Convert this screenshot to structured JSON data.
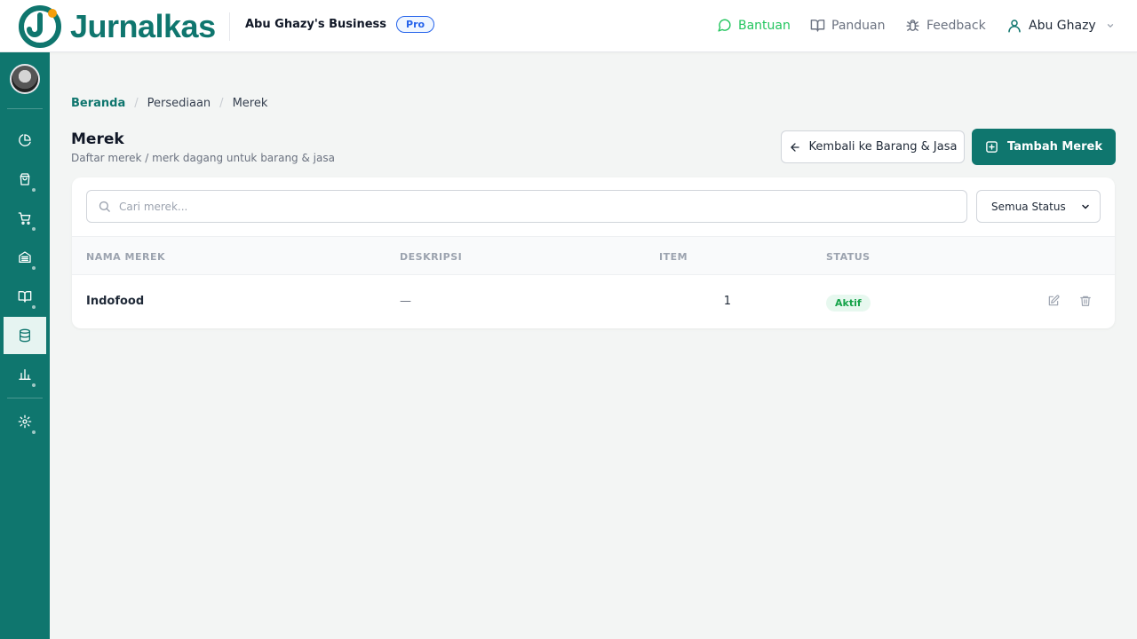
{
  "app": {
    "brand": "Jurnalkas",
    "business_name": "Abu Ghazy's Business",
    "plan_badge": "Pro",
    "accent": "#0f766e"
  },
  "header_nav": {
    "help": {
      "label": "Bantuan",
      "icon": "chat-bubble-icon"
    },
    "guide": {
      "label": "Panduan",
      "icon": "book-open-icon"
    },
    "feedback": {
      "label": "Feedback",
      "icon": "bug-icon"
    },
    "user": {
      "label": "Abu Ghazy",
      "icon": "user-icon"
    }
  },
  "sidebar": {
    "items": [
      {
        "name": "dashboard",
        "icon": "pie-chart-icon",
        "active": false
      },
      {
        "name": "sales",
        "icon": "shopping-bag-icon",
        "active": false
      },
      {
        "name": "purchases",
        "icon": "shopping-cart-icon",
        "active": false
      },
      {
        "name": "bank",
        "icon": "bank-icon",
        "active": false
      },
      {
        "name": "ledger",
        "icon": "book-icon",
        "active": false
      },
      {
        "name": "inventory",
        "icon": "database-icon",
        "active": true
      },
      {
        "name": "reports",
        "icon": "bar-chart-icon",
        "active": false
      },
      {
        "name": "settings",
        "icon": "gear-icon",
        "active": false
      }
    ]
  },
  "breadcrumb": {
    "home": "Beranda",
    "level1": "Persediaan",
    "current": "Merek",
    "separator": "/"
  },
  "page": {
    "title": "Merek",
    "subtitle": "Daftar merek / merk dagang untuk barang & jasa",
    "back_button": "Kembali ke Barang & Jasa",
    "add_button": "Tambah Merek"
  },
  "filters": {
    "search_placeholder": "Cari merek...",
    "search_value": "",
    "status_selected": "Semua Status"
  },
  "table": {
    "headers": {
      "name": "NAMA MEREK",
      "description": "DESKRIPSI",
      "items": "ITEM",
      "status": "STATUS"
    },
    "rows": [
      {
        "name": "Indofood",
        "description": "—",
        "items": "1",
        "status": "Aktif"
      }
    ]
  }
}
